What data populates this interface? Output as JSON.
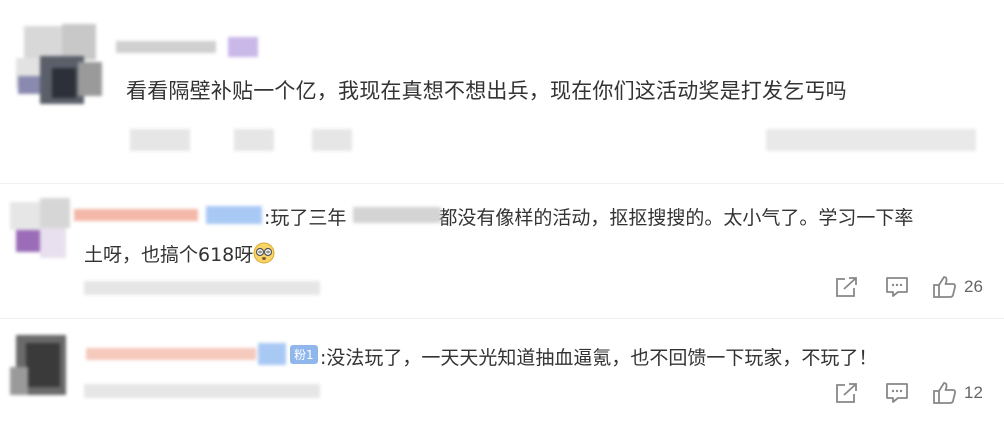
{
  "comments": [
    {
      "text": "看看隔壁补贴一个亿，我现在真想不想出兵，现在你们这活动奖是打发乞丐吗"
    },
    {
      "text_line1_a": ":玩了三年",
      "text_line1_b": "都没有像样的活动，抠抠搜搜的。太小气了。学习一下率",
      "text_line2": "土呀，也搞个618呀",
      "emoji": "dizzy-face-emoji",
      "likes": "26"
    },
    {
      "badge": "粉1",
      "text": ":没法玩了，一天天光知道抽血逼氪，也不回馈一下玩家，不玩了！",
      "likes": "12"
    }
  ],
  "icons": {
    "share": "share-icon",
    "comment": "comment-icon",
    "like": "thumbs-up-icon"
  },
  "colors": {
    "text": "#333333",
    "icon": "#888888",
    "badge_blue": "#a9c9f5",
    "name_pink": "#f4b8a8"
  }
}
